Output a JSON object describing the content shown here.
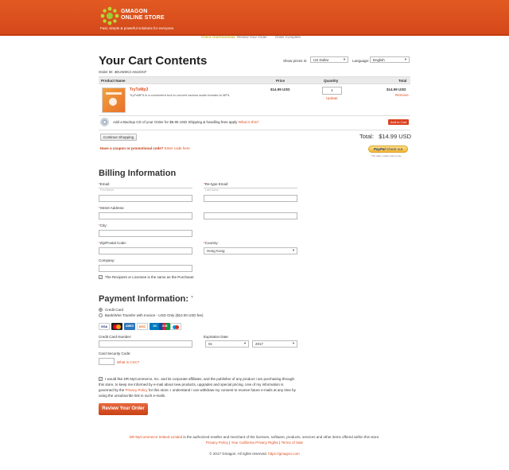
{
  "header": {
    "brand_line1": "GMAGON",
    "brand_line2": "ONLINE STORE",
    "tagline": "Fast, simple & powerful solutions for everyone."
  },
  "subnav": [
    "Check Out/Download",
    "Review Your Order",
    "Order Complete"
  ],
  "cart": {
    "title": "Your Cart Contents",
    "order_id_label": "Order ID: 3EUW2K2-A6UGN7",
    "show_prices_label": "Show prices in:",
    "currency": "US Dollar",
    "language_label": "Language:",
    "language": "English",
    "columns": {
      "product": "Product Name",
      "price": "Price",
      "quantity": "Quantity",
      "total": "Total"
    },
    "item": {
      "name": "TryToMp3",
      "desc": "TryToMP3 is a convenient tool to convert various audio formats to MP3.",
      "price": "$14.99 USD",
      "quantity": "1",
      "update": "Update",
      "total": "$14.99 USD",
      "remove": "Remove"
    },
    "backup": {
      "text": "Add a Backup CD of your Order for $6.95 USD Shipping & handling fees apply",
      "link": "What is this?",
      "button": "Add to Cart"
    },
    "continue_button": "Continue Shopping",
    "total_label": "Total:",
    "total_value": "$14.99 USD",
    "coupon_text": "Have a coupon or promotional code?",
    "coupon_link": "Enter code here",
    "paypal_label": "PayPal",
    "paypal_checkout": "Check out",
    "paypal_note": "The safer, easier way to pay"
  },
  "billing": {
    "title": "Billing Information",
    "email_label": "Email:",
    "retype_email_label": "Re-type Email:",
    "first_name_placeholder": "First Name",
    "last_name_placeholder": "Last Name",
    "street_label": "Street Address:",
    "city_label": "City:",
    "zip_label": "Zip/Postal Code:",
    "country_label": "Country:",
    "country_value": "Hong Kong",
    "company_label": "Company:",
    "same_as_purchaser": "The Recipient or Licensee is the same as the Purchaser."
  },
  "payment": {
    "title": "Payment Information:",
    "help_mark": "?",
    "option_credit": "Credit Card",
    "option_bank": "Bank/Wire Transfer with Invoice - USD Only ($10.00 USD fee)",
    "cards": [
      "VISA",
      "MC",
      "AMEX",
      "DISC",
      "DC",
      "JCB",
      "MAE"
    ],
    "card_number_label": "Credit Card Number:",
    "expiration_label": "Expiration Date",
    "exp_month": "01",
    "exp_year": "2017",
    "csc_label": "Card Security Code:",
    "csc_link": "What is CSC?",
    "consent_pre": "I would like DR MyCommerce, Inc. and its corporate affiliates, and the publisher of any product I am purchasing through this store, to keep me informed by e-mail about new products, upgrades and special pricing. Use of my information is governed by the",
    "consent_link": "Privacy Policy",
    "consent_post": "for this store. I understand I can withdraw my consent to receive future e-mails at any time by using the unsubscribe link in such e-mails.",
    "review_button": "Review Your Order"
  },
  "footer": {
    "reseller_link": "DR MyCommerce Ireland Limited",
    "reseller_text": "is the authorized reseller and merchant of the licenses, software, products, services and other items offered within this store.",
    "privacy": "Privacy Policy",
    "california": "Your California Privacy Rights",
    "terms": "Terms of Sale",
    "copyright": "© 2017 Gmagon. All rights reserved.",
    "site_link": "https://gmagon.com"
  },
  "colors": {
    "brand": "#d94a1c",
    "accent_link": "#e04d1e"
  }
}
